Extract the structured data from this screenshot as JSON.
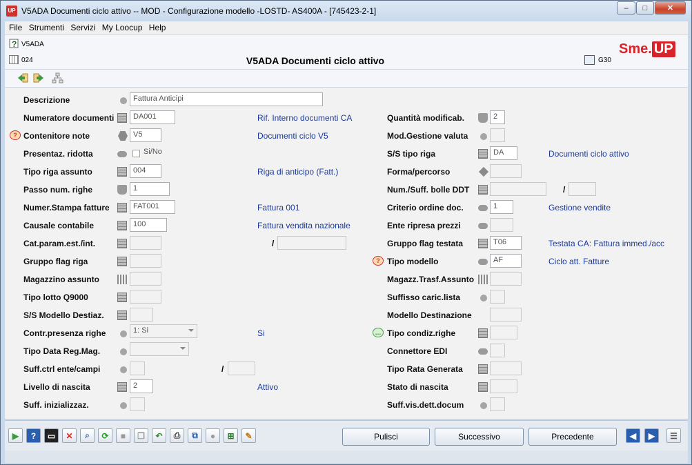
{
  "window": {
    "title": "V5ADA Documenti ciclo attivo  -- MOD - Configurazione modello -LOSTD- AS400A - [745423-2-1]",
    "app_icon": "UP",
    "minimize": "–",
    "maximize": "□",
    "close": "✕"
  },
  "menu": [
    "File",
    "Strumenti",
    "Servizi",
    "My Loocup",
    "Help"
  ],
  "header": {
    "code": "V5ADA",
    "number": "024",
    "title": "V5ADA Documenti ciclo attivo",
    "g30": "G30",
    "logo_a": "Sme.",
    "logo_b": "UP"
  },
  "form": {
    "descrizione": {
      "label": "Descrizione",
      "value": "Fattura Anticipi"
    },
    "numeratore": {
      "label": "Numeratore documenti",
      "value": "DA001",
      "desc": "Rif. Interno documenti CA"
    },
    "contenitore": {
      "label": "Contenitore note",
      "value": "V5",
      "desc": "Documenti ciclo V5"
    },
    "presentaz": {
      "label": "Presentaz. ridotta",
      "value": "Si/No"
    },
    "tipo_riga": {
      "label": "Tipo riga assunto",
      "value": "004",
      "desc": "Riga di anticipo (Fatt.)"
    },
    "passo": {
      "label": "Passo num. righe",
      "value": "1"
    },
    "numer_stampa": {
      "label": "Numer.Stampa fatture",
      "value": "FAT001",
      "desc": "Fattura 001"
    },
    "causale": {
      "label": "Causale contabile",
      "value": "100",
      "desc": "Fattura vendita nazionale"
    },
    "cat_param": {
      "label": "Cat.param.est./int.",
      "value": "",
      "slash": "/",
      "value2": ""
    },
    "gruppo_flag_riga": {
      "label": "Gruppo flag riga",
      "value": ""
    },
    "magazzino": {
      "label": "Magazzino assunto",
      "value": ""
    },
    "tipo_lotto": {
      "label": "Tipo lotto Q9000",
      "value": ""
    },
    "ss_modello": {
      "label": "S/S Modello Destiaz.",
      "value": ""
    },
    "contr_presenza": {
      "label": "Contr.presenza righe",
      "value": "1: Si",
      "desc": "Si"
    },
    "tipo_data": {
      "label": "Tipo Data Reg.Mag.",
      "value": ""
    },
    "suff_ctrl": {
      "label": "Suff.ctrl ente/campi",
      "value": "",
      "slash": "/",
      "value2": ""
    },
    "livello": {
      "label": "Livello di nascita",
      "value": "2",
      "desc": "Attivo"
    },
    "suff_iniz": {
      "label": "Suff. inizializzaz.",
      "value": ""
    },
    "quantita": {
      "label": "Quantità modificab.",
      "value": "2"
    },
    "mod_gestione": {
      "label": "Mod.Gestione valuta",
      "value": ""
    },
    "ss_tipo_riga": {
      "label": "S/S tipo riga",
      "value": "DA",
      "desc": "Documenti ciclo attivo"
    },
    "forma": {
      "label": "Forma/percorso",
      "value": ""
    },
    "num_suff": {
      "label": "Num./Suff. bolle DDT",
      "value": "",
      "slash": "/",
      "value2": ""
    },
    "criterio": {
      "label": "Criterio ordine doc.",
      "value": "1",
      "desc": "Gestione vendite"
    },
    "ente_ripresa": {
      "label": "Ente ripresa prezzi",
      "value": ""
    },
    "gruppo_flag_testata": {
      "label": "Gruppo flag testata",
      "value": "T06",
      "desc": "Testata CA: Fattura immed./acc"
    },
    "tipo_modello": {
      "label": "Tipo modello",
      "value": "AF",
      "desc": "Ciclo att.  Fatture"
    },
    "magazz_trasf": {
      "label": "Magazz.Trasf.Assunto",
      "value": ""
    },
    "suffisso_caric": {
      "label": "Suffisso caric.lista",
      "value": ""
    },
    "modello_dest": {
      "label": "Modello Destinazione",
      "value": ""
    },
    "tipo_condiz": {
      "label": "Tipo condiz.righe",
      "value": ""
    },
    "connettore": {
      "label": "Connettore EDI",
      "value": ""
    },
    "tipo_rata": {
      "label": "Tipo Rata Generata",
      "value": ""
    },
    "stato_nascita": {
      "label": "Stato di nascita",
      "value": ""
    },
    "suff_vis": {
      "label": "Suff.vis.dett.docum",
      "value": ""
    }
  },
  "buttons": {
    "pulisci": "Pulisci",
    "successivo": "Successivo",
    "precedente": "Precedente"
  }
}
